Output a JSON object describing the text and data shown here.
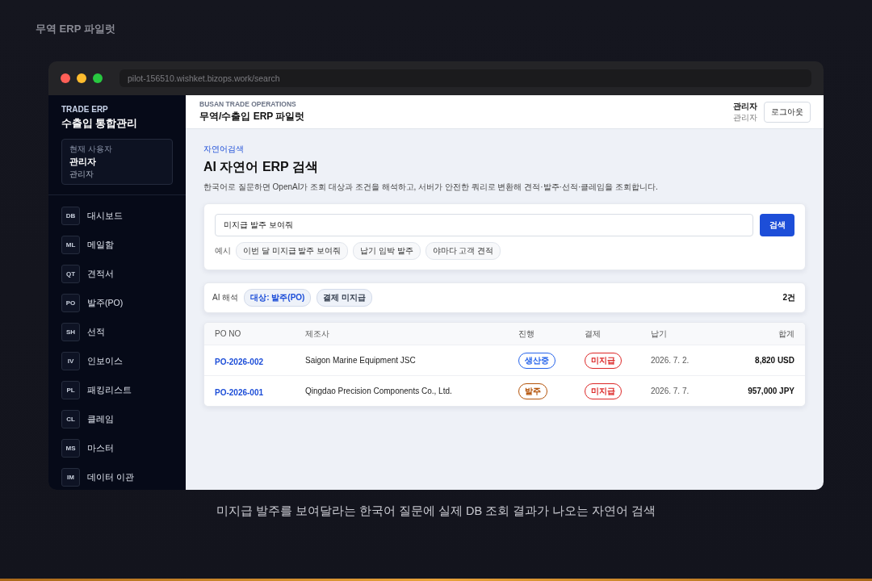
{
  "page_title": "무역 ERP 파일럿",
  "browser": {
    "url": "pilot-156510.wishket.bizops.work/search"
  },
  "sidebar": {
    "brand": "TRADE ERP",
    "title": "수출입 통합관리",
    "user_label": "현재 사용자",
    "user_name": "관리자",
    "user_role": "관리자",
    "items": [
      {
        "code": "DB",
        "label": "대시보드"
      },
      {
        "code": "ML",
        "label": "메일함"
      },
      {
        "code": "QT",
        "label": "견적서"
      },
      {
        "code": "PO",
        "label": "발주(PO)"
      },
      {
        "code": "SH",
        "label": "선적"
      },
      {
        "code": "IV",
        "label": "인보이스"
      },
      {
        "code": "PL",
        "label": "패킹리스트"
      },
      {
        "code": "CL",
        "label": "클레임"
      },
      {
        "code": "MS",
        "label": "마스터"
      },
      {
        "code": "IM",
        "label": "데이터 이관"
      }
    ]
  },
  "header": {
    "eyebrow": "BUSAN TRADE OPERATIONS",
    "title": "무역/수출입 ERP 파일럿",
    "user_name": "관리자",
    "user_role": "관리자",
    "logout": "로그아웃"
  },
  "search_page": {
    "eyebrow": "자연어검색",
    "title": "AI 자연어 ERP 검색",
    "description": "한국어로 질문하면 OpenAI가 조회 대상과 조건을 해석하고, 서버가 안전한 쿼리로 변환해 견적·발주·선적·클레임을 조회합니다.",
    "query": "미지급 발주 보여줘",
    "search_button": "검색",
    "examples_label": "예시",
    "examples": [
      "이번 달 미지급 발주 보여줘",
      "납기 임박 발주",
      "야마다 고객 견적"
    ]
  },
  "interpretation": {
    "label": "AI 해석",
    "tags": [
      {
        "text": "대상: 발주(PO)",
        "color": "#1d4ed8"
      },
      {
        "text": "결제 미지급",
        "color": "#374151"
      }
    ],
    "count": "2건"
  },
  "table": {
    "columns": [
      "PO NO",
      "제조사",
      "진행",
      "결제",
      "납기",
      "합계"
    ],
    "rows": [
      {
        "po_no": "PO-2026-002",
        "maker": "Saigon Marine Equipment JSC",
        "progress": {
          "text": "생산중",
          "color": "#2563eb"
        },
        "payment": {
          "text": "미지급",
          "color": "#dc2626"
        },
        "due": "2026. 7. 2.",
        "total": "8,820 USD"
      },
      {
        "po_no": "PO-2026-001",
        "maker": "Qingdao Precision Components Co., Ltd.",
        "progress": {
          "text": "발주",
          "color": "#b45309"
        },
        "payment": {
          "text": "미지급",
          "color": "#dc2626"
        },
        "due": "2026. 7. 7.",
        "total": "957,000 JPY"
      }
    ]
  },
  "caption": "미지급 발주를 보여달라는 한국어 질문에 실제 DB 조회 결과가 나오는 자연어 검색"
}
